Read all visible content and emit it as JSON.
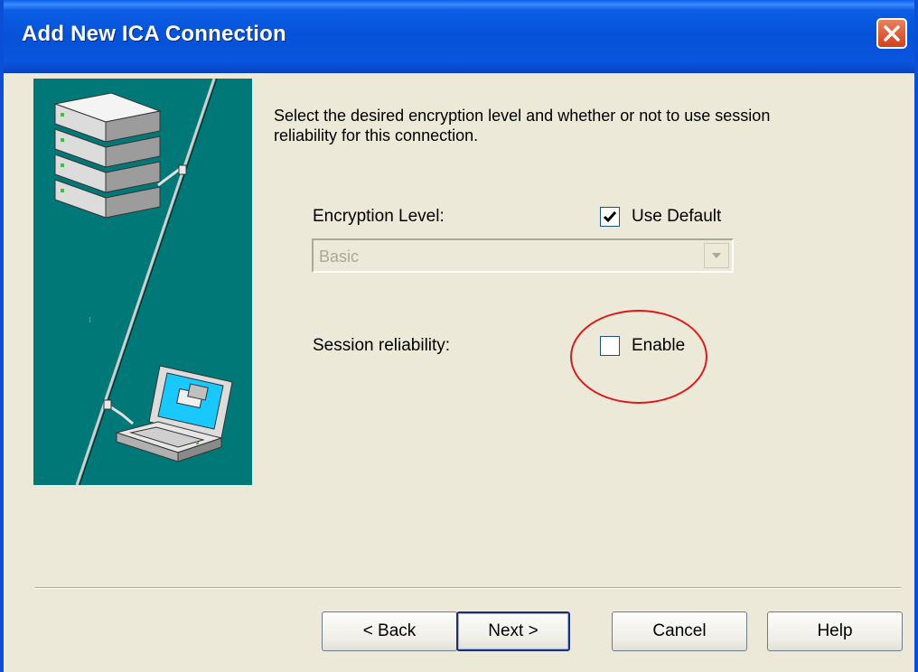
{
  "window": {
    "title": "Add New ICA Connection",
    "close_icon": "close-icon"
  },
  "description": "Select the desired encryption level and whether or not to use session reliability for this connection.",
  "encryption": {
    "label": "Encryption Level:",
    "use_default_label": "Use Default",
    "use_default_checked": true,
    "selected_value": "Basic",
    "enabled": false
  },
  "session_reliability": {
    "label": "Session reliability:",
    "enable_label": "Enable",
    "enable_checked": false
  },
  "buttons": {
    "back": "< Back",
    "next": "Next >",
    "cancel": "Cancel",
    "help": "Help"
  },
  "colors": {
    "titlebar": "#0552d8",
    "illustration_bg": "#007878",
    "dialog_bg": "#ece9d8",
    "highlight": "#e01818"
  }
}
